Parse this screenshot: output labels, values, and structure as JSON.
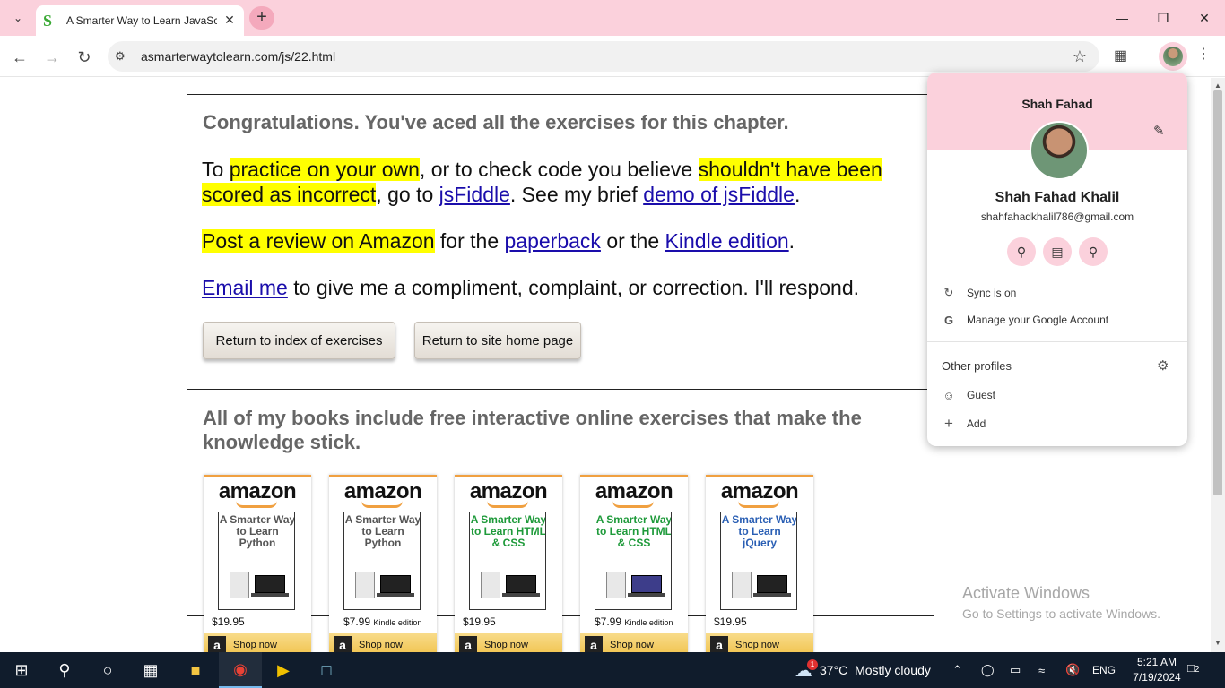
{
  "browser": {
    "tab_title": "A Smarter Way to Learn JavaScript",
    "url": "asmarterwaytolearn.com/js/22.html"
  },
  "page": {
    "congrats": "Congratulations. You've aced all the exercises for this chapter.",
    "p1": {
      "t1": "To ",
      "h1": "practice on your own",
      "t2": ", or to check code you believe ",
      "h2": "shouldn't have been scored as incorrect",
      "t3": ", go to ",
      "l1": "jsFiddle",
      "t4": ". See my brief ",
      "l2": "demo of jsFiddle",
      "t5": "."
    },
    "p2": {
      "h1": "Post a review on Amazon",
      "t1": " for the ",
      "l1": "paperback",
      "t2": " or the ",
      "l2": "Kindle edition",
      "t3": "."
    },
    "p3": {
      "l1": "Email me",
      "t1": " to give me a compliment, complaint, or correction. I'll respond."
    },
    "btn_index": "Return to index of exercises",
    "btn_home": "Return to site home page",
    "books_heading": "All of my books include free interactive online exercises that make the knowledge stick.",
    "books": [
      {
        "brand": "amazon",
        "title": "A Smarter Way to Learn Python",
        "price": "$19.95",
        "edition": "",
        "shop": "Shop now",
        "color": "#555555"
      },
      {
        "brand": "amazon",
        "title": "A Smarter Way to Learn Python",
        "price": "$7.99",
        "edition": "Kindle edition",
        "shop": "Shop now",
        "color": "#555555"
      },
      {
        "brand": "amazon",
        "title": "A Smarter Way to Learn HTML & CSS",
        "price": "$19.95",
        "edition": "",
        "shop": "Shop now",
        "color": "#1e9a3a"
      },
      {
        "brand": "amazon",
        "title": "A Smarter Way to Learn HTML & CSS",
        "price": "$7.99",
        "edition": "Kindle edition",
        "shop": "Shop now",
        "color": "#1e9a3a"
      },
      {
        "brand": "amazon",
        "title": "A Smarter Way to Learn jQuery",
        "price": "$19.95",
        "edition": "",
        "shop": "Shop now",
        "color": "#2a5fb4"
      }
    ],
    "activate_title": "Activate Windows",
    "activate_sub": "Go to Settings to activate Windows."
  },
  "profile": {
    "name_top": "Shah Fahad",
    "full_name": "Shah Fahad Khalil",
    "email": "shahfahadkhalil786@gmail.com",
    "sync": "Sync is on",
    "manage": "Manage your Google Account",
    "other_profiles": "Other profiles",
    "guest": "Guest",
    "add": "Add"
  },
  "taskbar": {
    "weather_temp": "37°C",
    "weather_desc": "Mostly cloudy",
    "weather_badge": "1",
    "lang": "ENG",
    "time": "5:21 AM",
    "date": "7/19/2024",
    "notif_count": "2"
  }
}
